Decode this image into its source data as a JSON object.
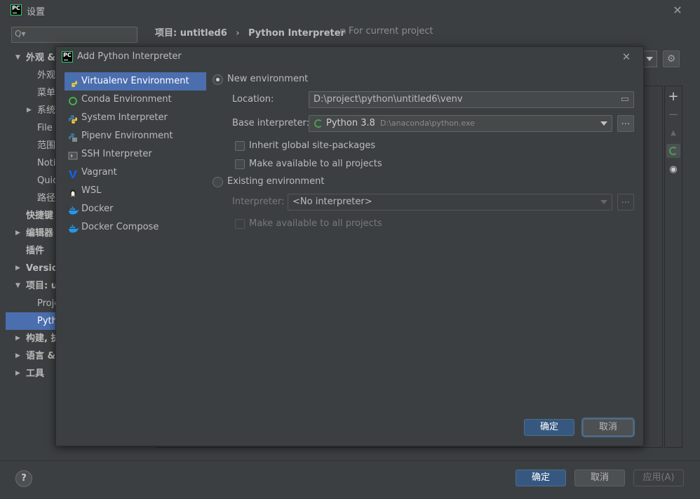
{
  "window": {
    "title": "设置"
  },
  "search": {
    "placeholder": "Q▾"
  },
  "breadcrumb": {
    "project": "项目: untitled6",
    "separator": "›",
    "page": "Python Interpreter",
    "scope": "For current project"
  },
  "sidebar": {
    "items": [
      {
        "label": "外观 &",
        "level": 0,
        "arrow": "▼"
      },
      {
        "label": "外观",
        "level": 1,
        "arrow": ""
      },
      {
        "label": "菜单",
        "level": 1,
        "arrow": ""
      },
      {
        "label": "系统",
        "level": 1,
        "arrow": "▶"
      },
      {
        "label": "File C",
        "level": 1,
        "arrow": ""
      },
      {
        "label": "范围",
        "level": 1,
        "arrow": ""
      },
      {
        "label": "Notif",
        "level": 1,
        "arrow": ""
      },
      {
        "label": "Quic",
        "level": 1,
        "arrow": ""
      },
      {
        "label": "路径",
        "level": 1,
        "arrow": ""
      },
      {
        "label": "快捷键",
        "level": 0,
        "arrow": ""
      },
      {
        "label": "编辑器",
        "level": 0,
        "arrow": "▶"
      },
      {
        "label": "插件",
        "level": 0,
        "arrow": ""
      },
      {
        "label": "Version",
        "level": 0,
        "arrow": "▶"
      },
      {
        "label": "项目: un",
        "level": 0,
        "arrow": "▼"
      },
      {
        "label": "Proje",
        "level": 1,
        "arrow": ""
      },
      {
        "label": "Pytho",
        "level": 1,
        "arrow": "",
        "selected": true
      },
      {
        "label": "构建, 执",
        "level": 0,
        "arrow": "▶"
      },
      {
        "label": "语言 &",
        "level": 0,
        "arrow": "▶"
      },
      {
        "label": "工具",
        "level": 0,
        "arrow": "▶"
      }
    ]
  },
  "footer": {
    "help": "?",
    "ok": "确定",
    "cancel": "取消",
    "apply": "应用(A)"
  },
  "dialog": {
    "title": "Add Python Interpreter",
    "close": "✕",
    "env_types": [
      {
        "label": "Virtualenv Environment",
        "icon": "python-icon",
        "selected": true
      },
      {
        "label": "Conda Environment",
        "icon": "conda-icon"
      },
      {
        "label": "System Interpreter",
        "icon": "python-icon"
      },
      {
        "label": "Pipenv Environment",
        "icon": "pipenv-icon"
      },
      {
        "label": "SSH Interpreter",
        "icon": "terminal-icon"
      },
      {
        "label": "Vagrant",
        "icon": "vagrant-icon"
      },
      {
        "label": "WSL",
        "icon": "linux-penguin-icon"
      },
      {
        "label": "Docker",
        "icon": "docker-icon"
      },
      {
        "label": "Docker Compose",
        "icon": "docker-icon"
      }
    ],
    "new_env": {
      "label": "New environment",
      "location_label": "Location:",
      "location_value": "D:\\project\\python\\untitled6\\venv",
      "base_label": "Base interpreter:",
      "base_name": "Python 3.8",
      "base_path": "D:\\anaconda\\python.exe",
      "inherit_label": "Inherit global site-packages",
      "available_label": "Make available to all projects"
    },
    "existing_env": {
      "label": "Existing environment",
      "interpreter_label": "Interpreter:",
      "interpreter_value": "<No interpreter>",
      "available_label": "Make available to all projects"
    },
    "dots": "...",
    "ok": "确定",
    "cancel": "取消"
  },
  "colors": {
    "accent": "#4b6eaf",
    "background": "#3c3f41",
    "primary_button": "#365880",
    "python_green": "#499c54"
  }
}
